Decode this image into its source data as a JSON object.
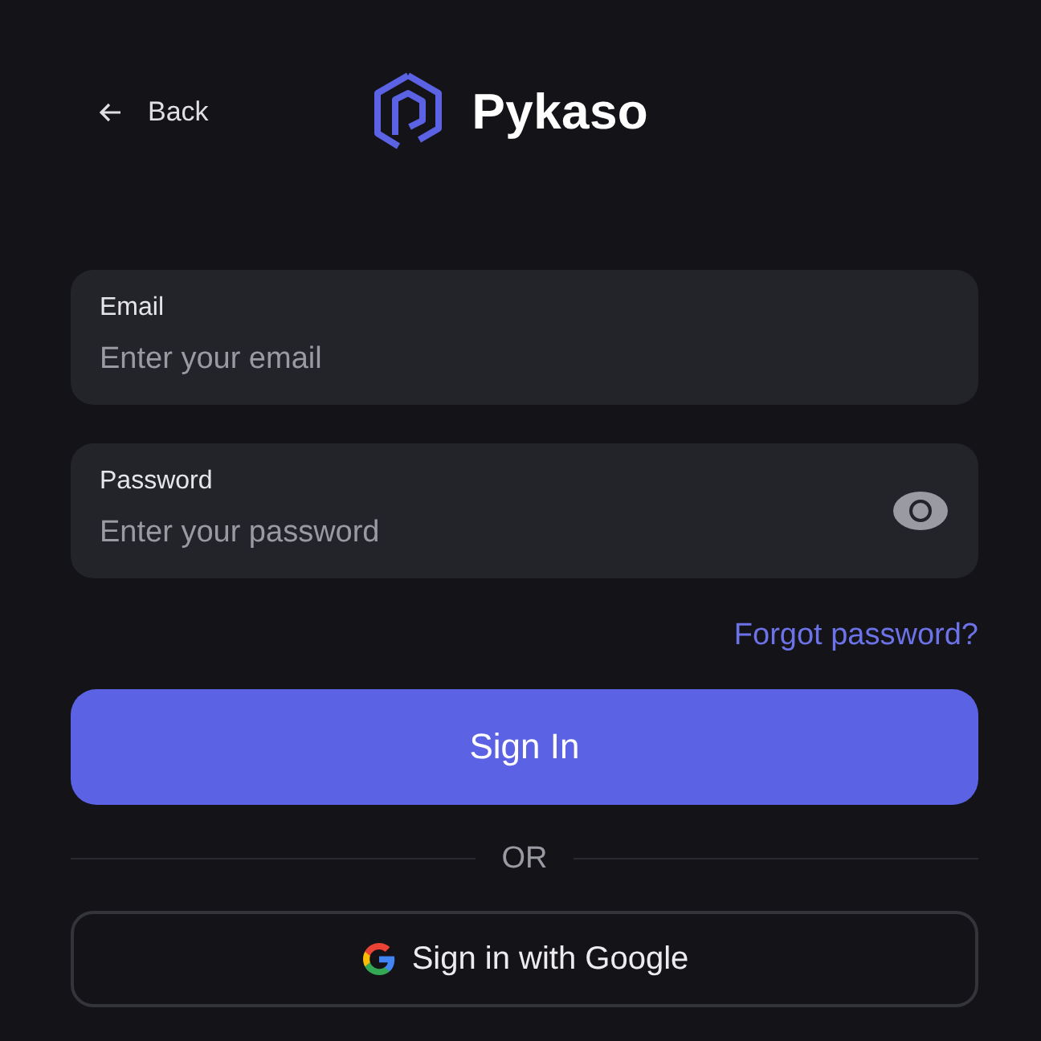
{
  "header": {
    "back_label": "Back",
    "brand": "Pykaso"
  },
  "fields": [
    {
      "kind": "email",
      "label": "Email",
      "placeholder": "Enter your email"
    },
    {
      "kind": "password",
      "label": "Password",
      "placeholder": "Enter your password"
    }
  ],
  "forgot_link": "Forgot password?",
  "sign_in_button": "Sign In",
  "divider_text": "OR",
  "google_button": "Sign in with Google"
}
